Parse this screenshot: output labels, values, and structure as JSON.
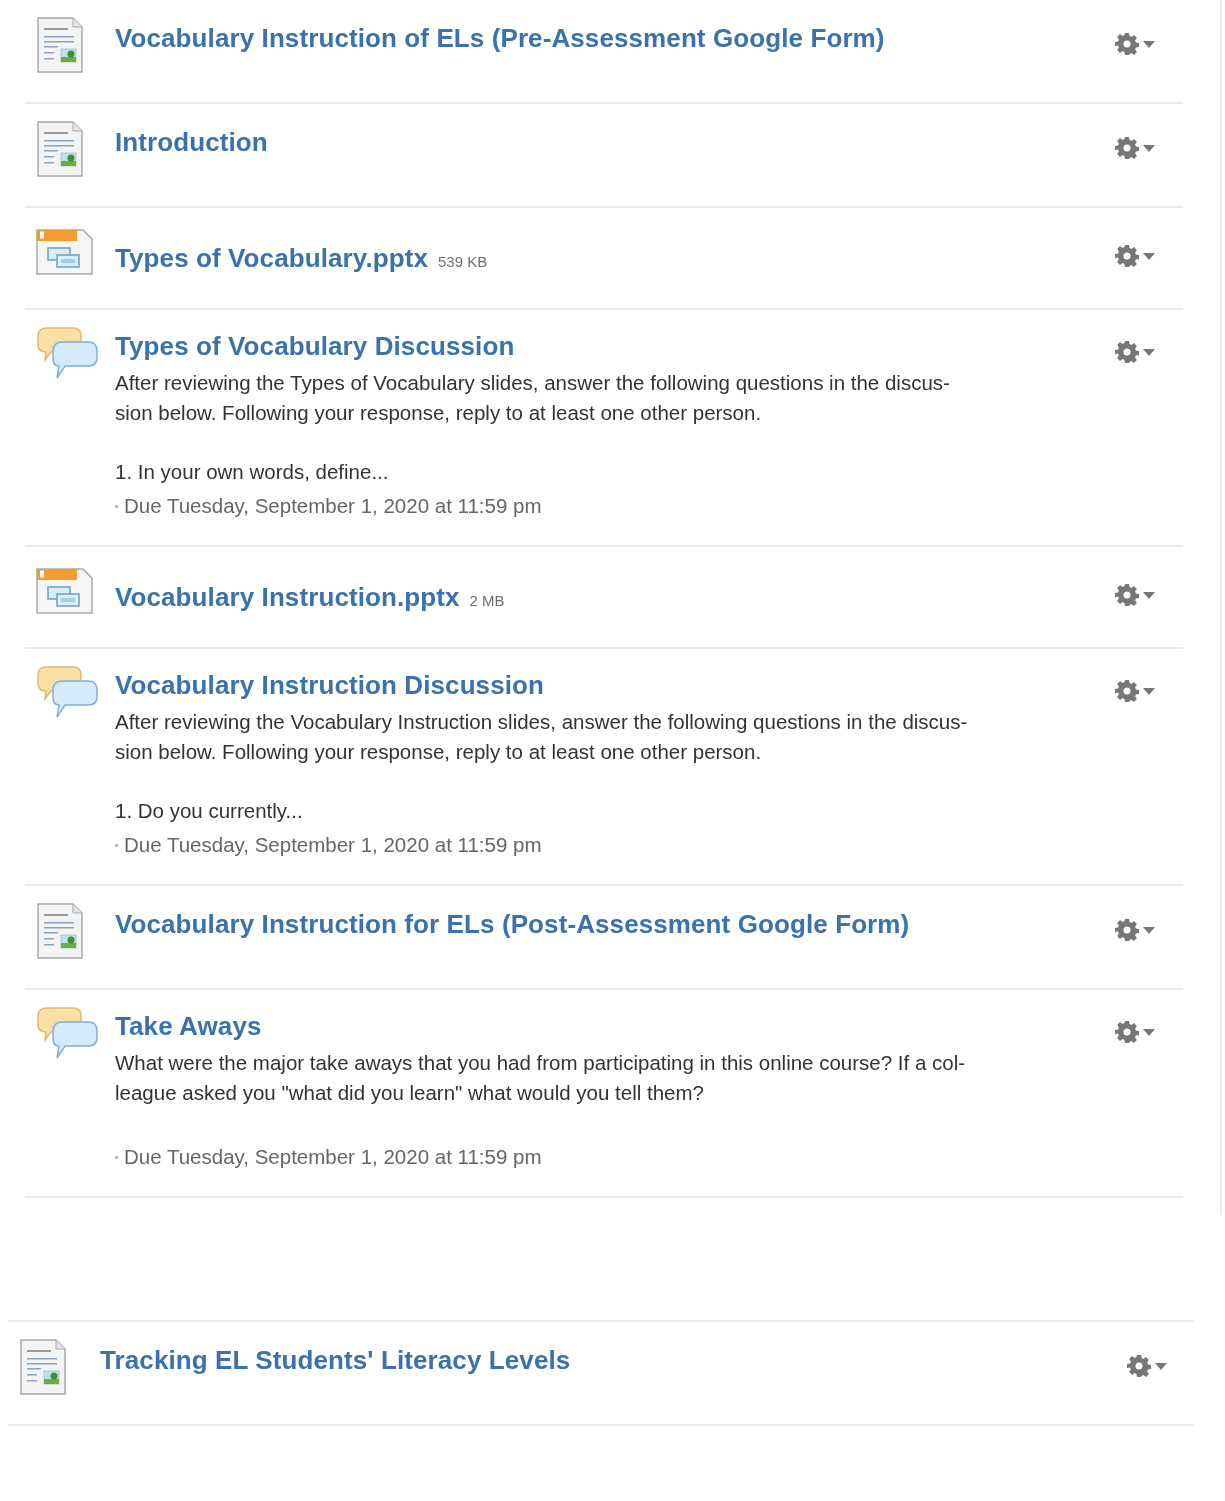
{
  "sections": [
    {
      "items": [
        {
          "kind": "page",
          "title": "Vocabulary Instruction of ELs (Pre-Assessment Google Form)"
        },
        {
          "kind": "page",
          "title": "Introduction"
        },
        {
          "kind": "pptx",
          "title": "Types of Vocabulary.pptx",
          "size": "539 KB"
        },
        {
          "kind": "discussion",
          "title": "Types of Vocabulary Discussion",
          "description": "After reviewing the Types of Vocabulary slides, answer the following questions in the discus-\nsion below. Following your response, reply to at least one other person.",
          "prompt": "1. In your own words, define...",
          "due": "Due Tuesday, September 1, 2020 at 11:59 pm"
        },
        {
          "kind": "pptx",
          "title": "Vocabulary Instruction.pptx",
          "size": "2 MB"
        },
        {
          "kind": "discussion",
          "title": "Vocabulary Instruction Discussion",
          "description": "After reviewing the Vocabulary Instruction slides, answer the following questions in the discus-\nsion below. Following your response, reply to at least one other person.",
          "prompt": "1. Do you currently...",
          "due": "Due Tuesday, September 1, 2020 at 11:59 pm"
        },
        {
          "kind": "page",
          "title": "Vocabulary Instruction for ELs (Post-Assessment Google Form)"
        },
        {
          "kind": "discussion",
          "title": "Take Aways",
          "description": "What were the major take aways that you had from participating in this online course? If a col-\nleague asked you \"what did you learn\" what would you tell them?",
          "due": "Due Tuesday, September 1, 2020 at 11:59 pm"
        }
      ]
    },
    {
      "items": [
        {
          "kind": "page",
          "title": "Tracking EL Students' Literacy Levels"
        }
      ]
    }
  ]
}
